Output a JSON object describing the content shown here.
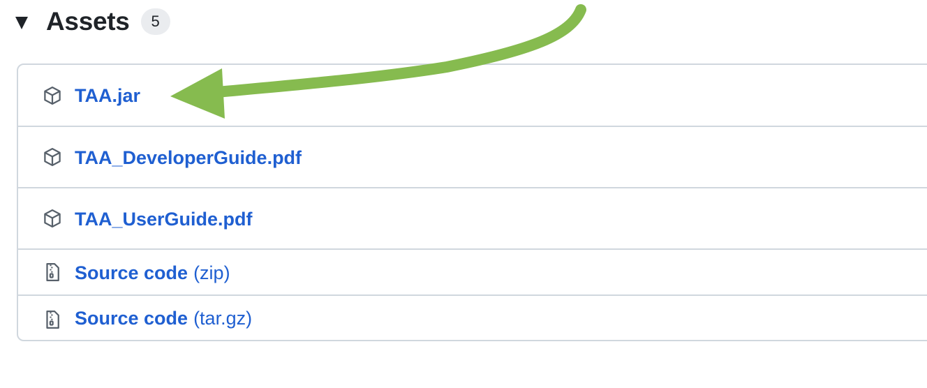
{
  "header": {
    "title": "Assets",
    "count": "5"
  },
  "assets": [
    {
      "name": "TAA.jar",
      "suffix": "",
      "icon": "package-icon"
    },
    {
      "name": "TAA_DeveloperGuide.pdf",
      "suffix": "",
      "icon": "package-icon"
    },
    {
      "name": "TAA_UserGuide.pdf",
      "suffix": "",
      "icon": "package-icon"
    },
    {
      "name": "Source code",
      "suffix": "(zip)",
      "icon": "file-zip-icon"
    },
    {
      "name": "Source code",
      "suffix": "(tar.gz)",
      "icon": "file-zip-icon"
    }
  ],
  "colors": {
    "link": "#1f5fd1",
    "border": "#d0d7de",
    "arrow": "#86bb4f",
    "text": "#1f2328"
  },
  "annotation": {
    "arrow_icon": "green-arrow-pointing-left"
  }
}
